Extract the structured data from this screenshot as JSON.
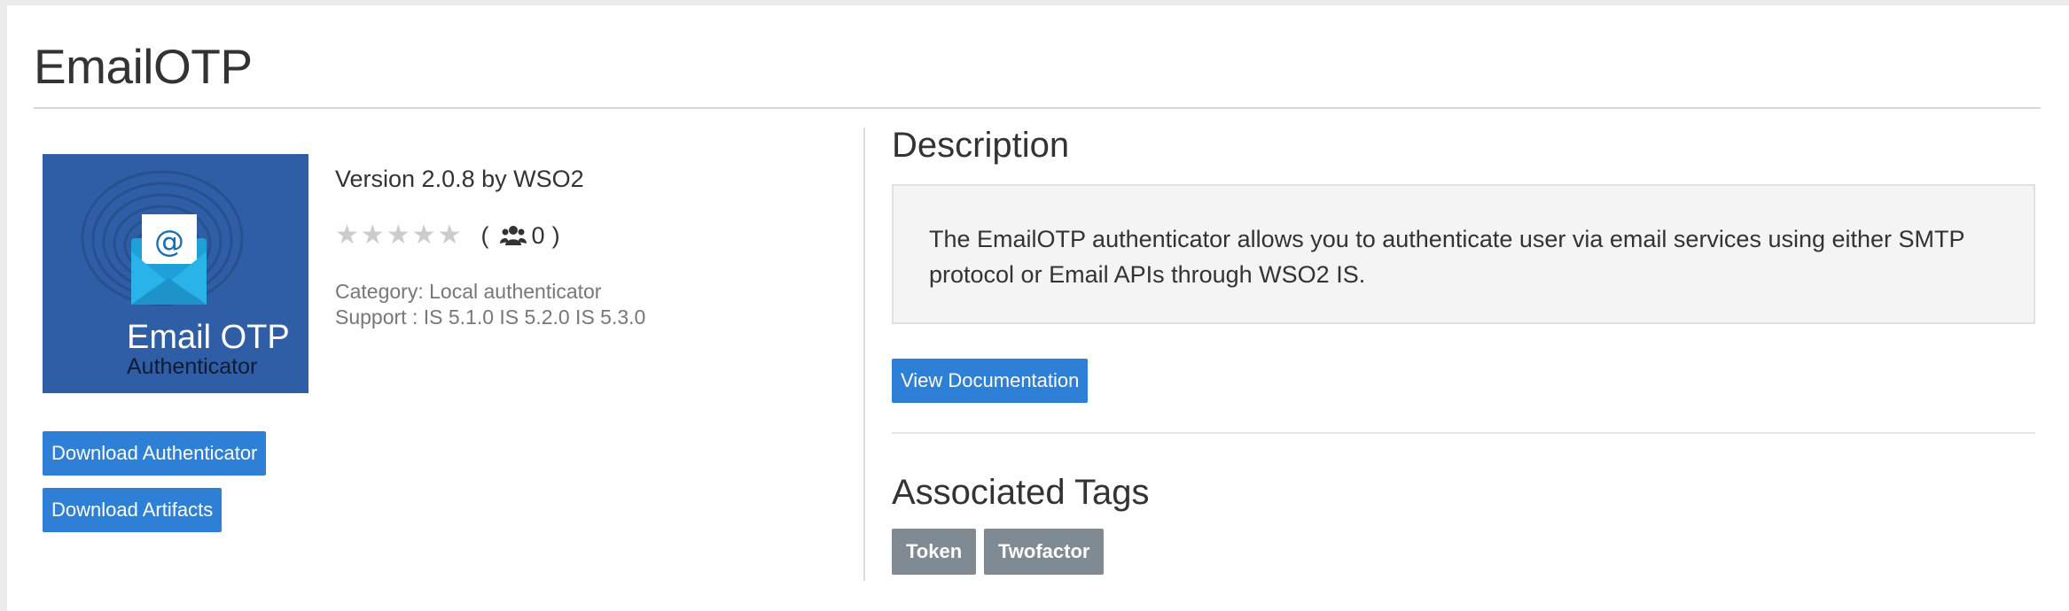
{
  "page": {
    "title": "EmailOTP"
  },
  "product": {
    "logo": {
      "title": "Email OTP",
      "subtitle": "Authenticator",
      "icon": "email-at-fingerprint-icon"
    },
    "version_line": "Version 2.0.8 by WSO2",
    "rating": {
      "stars": 5,
      "filled": 0,
      "open_paren": "(",
      "count": "0",
      "close_paren": ")",
      "icon": "users-icon"
    },
    "category": "Category: Local authenticator",
    "support": "Support : IS 5.1.0 IS 5.2.0 IS 5.3.0",
    "buttons": {
      "download_authenticator": "Download Authenticator",
      "download_artifacts": "Download Artifacts"
    }
  },
  "description": {
    "heading": "Description",
    "text": "The EmailOTP authenticator allows you to authenticate user via email services using either SMTP protocol or Email APIs through WSO2 IS.",
    "view_documentation": "View Documentation"
  },
  "tags": {
    "heading": "Associated Tags",
    "items": [
      "Token",
      "Twofactor"
    ]
  },
  "colors": {
    "button": "#2e7fd6",
    "tag": "#7f8a93",
    "logo_bg": "#2f5ea6",
    "star_empty": "#cccccc"
  }
}
